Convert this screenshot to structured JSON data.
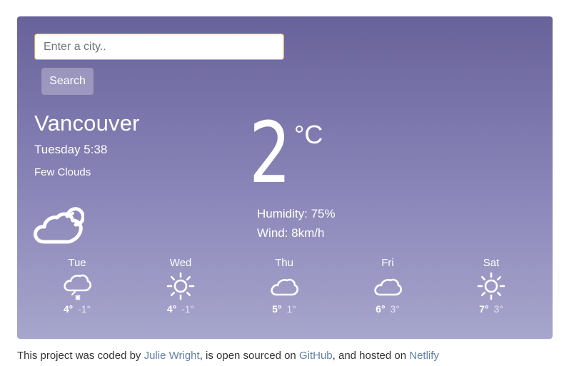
{
  "search": {
    "placeholder": "Enter a city..",
    "value": "",
    "button_label": "Search"
  },
  "current": {
    "city": "Vancouver",
    "datetime": "Tuesday 5:38",
    "description": "Few Clouds",
    "icon": "partly-cloudy-icon",
    "temperature": "2",
    "unit": "°C",
    "humidity": "Humidity: 75%",
    "wind": "Wind: 8km/h"
  },
  "forecast": [
    {
      "day": "Tue",
      "icon": "snow-cloud-icon",
      "max": "4°",
      "min": "-1°"
    },
    {
      "day": "Wed",
      "icon": "sun-icon",
      "max": "4°",
      "min": "-1°"
    },
    {
      "day": "Thu",
      "icon": "cloud-icon",
      "max": "5°",
      "min": "1°"
    },
    {
      "day": "Fri",
      "icon": "cloud-icon",
      "max": "6°",
      "min": "3°"
    },
    {
      "day": "Sat",
      "icon": "sun-icon",
      "max": "7°",
      "min": "3°"
    }
  ],
  "footer": {
    "text_1": "This project was coded by ",
    "author_link": "Julie Wright",
    "text_2": ", is open sourced on ",
    "github_link": "GitHub",
    "text_3": ", and hosted on ",
    "netlify_link": "Netlify"
  },
  "colors": {
    "card_top": "#68629a",
    "card_bottom": "#a7a6cc",
    "link": "#5f7fae",
    "input_border": "#e3a94c"
  }
}
